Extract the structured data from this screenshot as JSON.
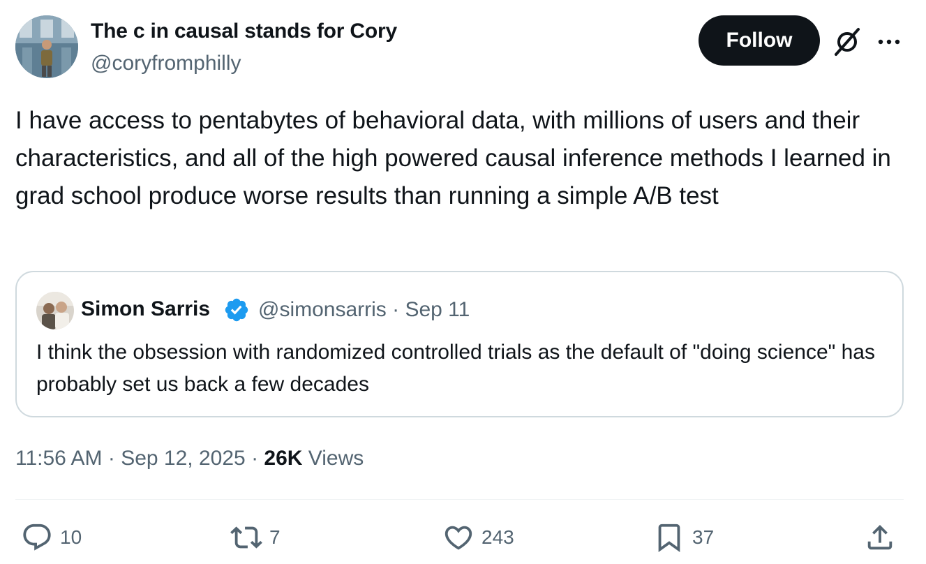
{
  "author": {
    "name": "The c in causal stands for Cory",
    "handle": "@coryfromphilly"
  },
  "header_actions": {
    "follow_label": "Follow",
    "grok_icon": "grok-icon",
    "more_icon": "more-icon"
  },
  "tweet": {
    "text": "I have access to pentabytes of behavioral data, with millions of users and their characteristics, and all of the high powered causal inference methods I learned in grad school produce worse results than running a simple A/B test"
  },
  "quote": {
    "author_name": "Simon Sarris",
    "verified_icon": "verified-badge-icon",
    "handle_and_date": "@simonsarris · Sep 11",
    "text": "I think the obsession with randomized controlled trials as the default of \"doing science\" has probably set us back a few decades"
  },
  "meta": {
    "time": "11:56 AM",
    "date": "Sep 12, 2025",
    "separator": "·",
    "views_count": "26K",
    "views_label": "Views"
  },
  "actions": {
    "replies": "10",
    "reposts": "7",
    "likes": "243",
    "bookmarks": "37"
  },
  "colors": {
    "text_primary": "#0f1419",
    "text_secondary": "#536471",
    "border": "#cfd9de",
    "verified": "#1d9bf0",
    "follow_bg": "#0f1419"
  }
}
